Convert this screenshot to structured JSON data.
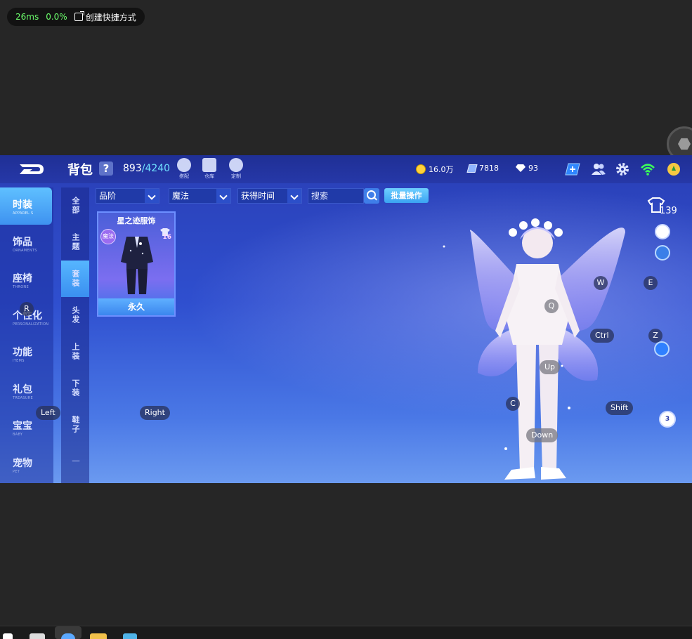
{
  "overlay": {
    "latency": "26ms",
    "loss": "0.0%",
    "shortcut_label": "创建快捷方式"
  },
  "header": {
    "title": "背包",
    "help_label": "?",
    "capacity_used": "893",
    "capacity_max": "/4240",
    "tools": [
      {
        "icon": "dye-icon",
        "label": "搭配"
      },
      {
        "icon": "warehouse-icon",
        "label": "仓库"
      },
      {
        "icon": "custom-icon",
        "label": "定制"
      }
    ],
    "currencies": {
      "gold": "16.0万",
      "tickets": "7818",
      "diamonds": "93"
    }
  },
  "categories": [
    {
      "cn": "时装",
      "en": "APPAREL S",
      "active": true
    },
    {
      "cn": "饰品",
      "en": "ORNAMENTS",
      "active": false
    },
    {
      "cn": "座椅",
      "en": "THRONE",
      "active": false
    },
    {
      "cn": "个性化",
      "en": "PERSONALIZATION",
      "active": false
    },
    {
      "cn": "功能",
      "en": "ITEMS",
      "active": false
    },
    {
      "cn": "礼包",
      "en": "TREASURE",
      "active": false
    },
    {
      "cn": "宝宝",
      "en": "BABY",
      "active": false
    },
    {
      "cn": "宠物",
      "en": "PET",
      "active": false
    }
  ],
  "sub_tabs": [
    {
      "label": "全部",
      "active": false
    },
    {
      "label": "主题",
      "active": false
    },
    {
      "label": "套装",
      "active": true
    },
    {
      "label": "头发",
      "active": false
    },
    {
      "label": "上装",
      "active": false
    },
    {
      "label": "下装",
      "active": false
    },
    {
      "label": "鞋子",
      "active": false
    },
    {
      "label": "一",
      "active": false
    }
  ],
  "filters": {
    "grade": "品阶",
    "type": "魔法",
    "time": "获得时间",
    "search_placeholder": "搜索",
    "batch_label": "批量操作"
  },
  "items": [
    {
      "name": "星之迹服饰",
      "tag": "魔法",
      "level": "16",
      "duration": "永久"
    }
  ],
  "wardrobe_count": "139",
  "outfit_count": "3",
  "keymap": {
    "w": "W",
    "e": "E",
    "q": "Q",
    "ctrl": "Ctrl",
    "z": "Z",
    "up": "Up",
    "c": "C",
    "shift": "Shift",
    "down": "Down",
    "left": "Left",
    "right": "Right",
    "r": "R"
  },
  "colors": {
    "accent": "#3e92f0",
    "capacity_max": "#6fe1ff",
    "ping": "#6cff6c"
  }
}
